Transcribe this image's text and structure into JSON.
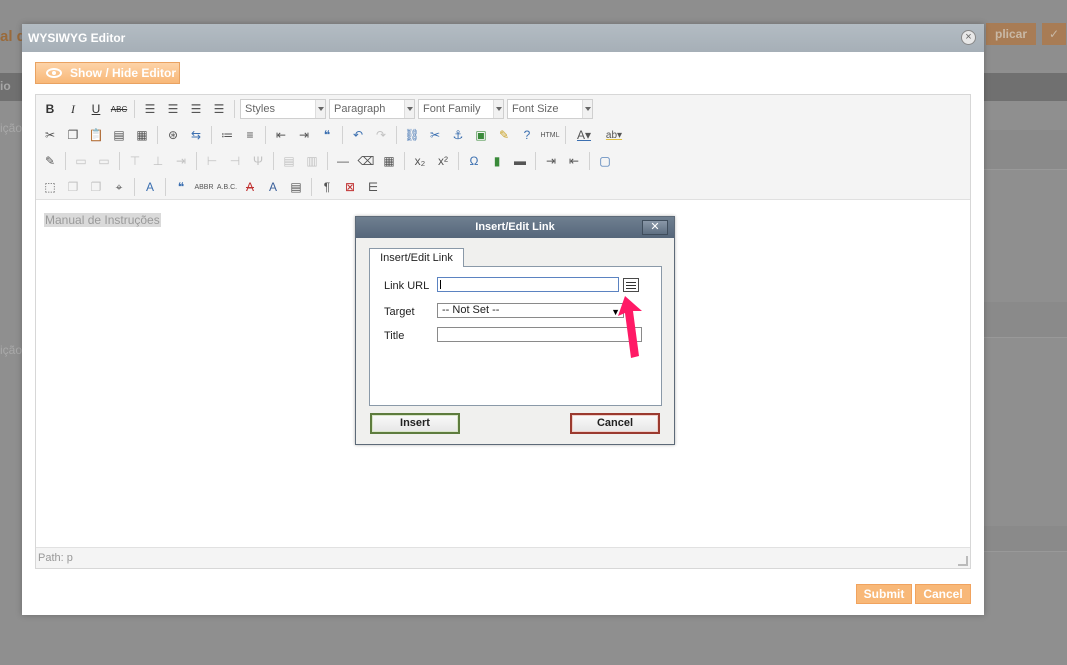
{
  "background": {
    "title_fragment": "al d",
    "apply_label": "plicar",
    "ok_label": "✓",
    "table_header_fragment": "io",
    "side_text_1": "ição",
    "side_text_2": "ição"
  },
  "modal": {
    "title": "WYSIWYG Editor",
    "close_label": "×",
    "show_hide_label": "Show / Hide Editor",
    "submit_label": "Submit",
    "cancel_label": "Cancel"
  },
  "toolbar": {
    "bold": "B",
    "italic": "I",
    "underline": "U",
    "strikethrough": "ABC",
    "styles": "Styles",
    "paragraph": "Paragraph",
    "font_family": "Font Family",
    "font_size": "Font Size",
    "html_label": "HTML",
    "text_color": "A",
    "highlight": "ab",
    "sub": "x₂",
    "sup": "x²",
    "omega": "Ω",
    "quote_marks": "❝",
    "abbr": "ABBR",
    "acronym": "A.B.C.",
    "pilcrow": "¶"
  },
  "editor": {
    "content_text": "Manual de Instruções",
    "path_label": "Path: p"
  },
  "dialog": {
    "title": "Insert/Edit Link",
    "close_label": "✕",
    "tab_label": "Insert/Edit Link",
    "link_url_label": "Link URL",
    "link_url_value": "",
    "target_label": "Target",
    "target_value": "-- Not Set --",
    "title_label": "Title",
    "title_value": "",
    "insert_label": "Insert",
    "cancel_label": "Cancel"
  },
  "colors": {
    "accent_orange": "#f8b878",
    "annotation_arrow": "#ff1a66",
    "dialog_header": "#55667a"
  }
}
